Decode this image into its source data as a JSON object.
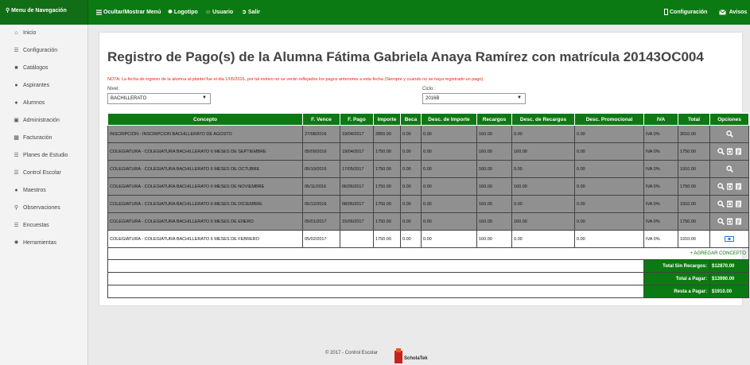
{
  "topbar": {
    "brand": "Menu de Navegación",
    "toggle_menu": "Ocultar/Mostrar Menú",
    "logotipo": "Logotipo",
    "usuario": "Usuario",
    "salir": "Salir",
    "configuracion": "Configuración",
    "avisos": "Avisos"
  },
  "sidebar": {
    "items": [
      {
        "label": "Inicio",
        "icon": "home-icon"
      },
      {
        "label": "Configuración",
        "icon": "list-icon"
      },
      {
        "label": "Catálogos",
        "icon": "folder-icon"
      },
      {
        "label": "Aspirantes",
        "icon": "user-icon"
      },
      {
        "label": "Alumnos",
        "icon": "users-icon"
      },
      {
        "label": "Administración",
        "icon": "briefcase-icon"
      },
      {
        "label": "Facturación",
        "icon": "truck-icon"
      },
      {
        "label": "Planes de Estudio",
        "icon": "list-icon"
      },
      {
        "label": "Control Escolar",
        "icon": "list-icon"
      },
      {
        "label": "Maestros",
        "icon": "users-icon"
      },
      {
        "label": "Observaciones",
        "icon": "search-icon"
      },
      {
        "label": "Encuestas",
        "icon": "list-icon"
      },
      {
        "label": "Herramientas",
        "icon": "gears-icon"
      }
    ]
  },
  "main": {
    "title": "Registro de Pago(s) de la Alumna Fátima Gabriela Anaya Ramírez con matrícula 20143OC004",
    "note": "NOTA: La fecha de ingreso de la alumna al plantel fue el dia 1/05/2016, por tal motivo no se verán reflejados los pagos anteriores a esta fecha (Siempre y cuando no se haya registrado un pago).",
    "nivel_label": "Nivel:",
    "nivel_value": "BACHILLERATO",
    "ciclo_label": "Ciclo :",
    "ciclo_value": "2016B"
  },
  "table": {
    "headers": [
      "Concepto",
      "F. Vence",
      "F. Pago",
      "Importe",
      "Beca",
      "Desc. de Importe",
      "Recargos",
      "Desc. de Recargos",
      "Desc. Promocional",
      "IVA",
      "Total",
      "Opciones"
    ],
    "rows": [
      {
        "concepto": "INSCRIPCIÓN - INSCRIPCION BACHILLERATO DE AGOSTO",
        "vence": "27/08/2016",
        "pago": "19/04/2017",
        "importe": "2850.00",
        "beca": "0.00",
        "desc_importe": "0.00",
        "recargos": "160.00",
        "desc_recargos": "0.00",
        "desc_promo": "0.00",
        "iva": "IVA 0%",
        "total": "3010.00",
        "opciones": [
          "search"
        ]
      },
      {
        "concepto": "COLEGIATURA - COLEGIATURA BACHILLERATO 6 MESES DE SEPTIEMBRE",
        "vence": "05/09/2016",
        "pago": "19/04/2017",
        "importe": "1750.00",
        "beca": "0.00",
        "desc_importe": "0.00",
        "recargos": "160.00",
        "desc_recargos": "160.00",
        "desc_promo": "0.00",
        "iva": "IVA 0%",
        "total": "1750.00",
        "opciones": [
          "search",
          "pdf",
          "xml"
        ]
      },
      {
        "concepto": "COLEGIATURA - COLEGIATURA BACHILLERATO 6 MESES DE OCTUBRE",
        "vence": "05/10/2016",
        "pago": "17/05/2017",
        "importe": "1750.00",
        "beca": "0.00",
        "desc_importe": "0.00",
        "recargos": "160.00",
        "desc_recargos": "0.00",
        "desc_promo": "0.00",
        "iva": "IVA 0%",
        "total": "1910.00",
        "opciones": [
          "search"
        ]
      },
      {
        "concepto": "COLEGIATURA - COLEGIATURA BACHILLERATO 6 MESES DE NOVIEMBRE",
        "vence": "05/11/2016",
        "pago": "06/06/2017",
        "importe": "1750.00",
        "beca": "0.00",
        "desc_importe": "0.00",
        "recargos": "160.00",
        "desc_recargos": "160.00",
        "desc_promo": "0.00",
        "iva": "IVA 0%",
        "total": "1750.00",
        "opciones": [
          "search",
          "pdf",
          "xml"
        ]
      },
      {
        "concepto": "COLEGIATURA - COLEGIATURA BACHILLERATO 6 MESES DE DICIEMBRE",
        "vence": "05/12/2016",
        "pago": "08/06/2017",
        "importe": "1750.00",
        "beca": "0.00",
        "desc_importe": "0.00",
        "recargos": "160.00",
        "desc_recargos": "0.00",
        "desc_promo": "0.00",
        "iva": "IVA 0%",
        "total": "1910.00",
        "opciones": [
          "search",
          "pdf",
          "xml"
        ]
      },
      {
        "concepto": "COLEGIATURA - COLEGIATURA BACHILLERATO 6 MESES DE ENERO",
        "vence": "05/01/2017",
        "pago": "15/06/2017",
        "importe": "1750.00",
        "beca": "0.00",
        "desc_importe": "0.00",
        "recargos": "160.00",
        "desc_recargos": "160.00",
        "desc_promo": "0.00",
        "iva": "IVA 0%",
        "total": "1750.00",
        "opciones": [
          "search",
          "pdf",
          "xml"
        ]
      },
      {
        "concepto": "COLEGIATURA - COLEGIATURA BACHILLERATO 6 MESES DE FEBRERO",
        "vence": "05/02/2017",
        "pago": "",
        "importe": "1750.00",
        "beca": "0.00",
        "desc_importe": "0.00",
        "recargos": "160.00",
        "desc_recargos": "0.00",
        "desc_promo": "0.00",
        "iva": "IVA 0%",
        "total": "1910.00",
        "opciones": [
          "pay"
        ]
      }
    ],
    "add_concept": "AGREGAR CONCEPTO",
    "totals": [
      {
        "label": "Total Sin Recargos:",
        "value": "$12870.00"
      },
      {
        "label": "Total a Pagar:",
        "value": "$13990.00"
      },
      {
        "label": "Resta a Pagar:",
        "value": "$1910.00"
      }
    ]
  },
  "footer": {
    "copyright": "© 2017 - Control Escolar",
    "logo_text": "ScholaTek"
  },
  "colors": {
    "primary": "#0c7a12",
    "paid_row": "#909090",
    "note": "#e21111"
  }
}
